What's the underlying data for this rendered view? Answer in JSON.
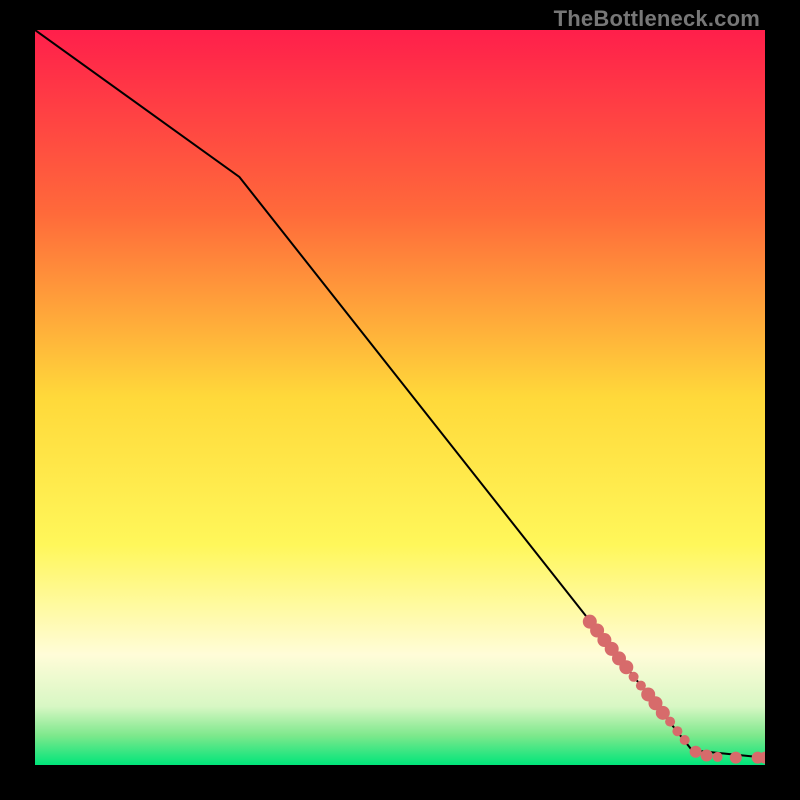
{
  "attribution": "TheBottleneck.com",
  "chart_data": {
    "type": "line",
    "title": "",
    "xlabel": "",
    "ylabel": "",
    "xlim": [
      0,
      100
    ],
    "ylim": [
      0,
      100
    ],
    "background_gradient": {
      "stops": [
        {
          "offset": 0.0,
          "color": "#ff1f4b"
        },
        {
          "offset": 0.25,
          "color": "#ff6a3a"
        },
        {
          "offset": 0.5,
          "color": "#ffd93a"
        },
        {
          "offset": 0.7,
          "color": "#fff75a"
        },
        {
          "offset": 0.85,
          "color": "#fffcd8"
        },
        {
          "offset": 0.92,
          "color": "#d8f7c4"
        },
        {
          "offset": 0.96,
          "color": "#7de88c"
        },
        {
          "offset": 1.0,
          "color": "#00e57a"
        }
      ]
    },
    "line": [
      {
        "x": 0,
        "y": 100
      },
      {
        "x": 28,
        "y": 80
      },
      {
        "x": 90,
        "y": 2
      },
      {
        "x": 100,
        "y": 1
      }
    ],
    "markers": {
      "color": "#d76b6b",
      "radius_small": 5,
      "radius_large": 7,
      "points": [
        {
          "x": 76.0,
          "y": 19.5,
          "r": 7
        },
        {
          "x": 77.0,
          "y": 18.3,
          "r": 7
        },
        {
          "x": 78.0,
          "y": 17.0,
          "r": 7
        },
        {
          "x": 79.0,
          "y": 15.8,
          "r": 7
        },
        {
          "x": 80.0,
          "y": 14.5,
          "r": 7
        },
        {
          "x": 81.0,
          "y": 13.3,
          "r": 7
        },
        {
          "x": 82.0,
          "y": 12.0,
          "r": 5
        },
        {
          "x": 83.0,
          "y": 10.8,
          "r": 5
        },
        {
          "x": 84.0,
          "y": 9.6,
          "r": 7
        },
        {
          "x": 85.0,
          "y": 8.4,
          "r": 7
        },
        {
          "x": 86.0,
          "y": 7.1,
          "r": 7
        },
        {
          "x": 87.0,
          "y": 5.9,
          "r": 5
        },
        {
          "x": 88.0,
          "y": 4.6,
          "r": 5
        },
        {
          "x": 89.0,
          "y": 3.4,
          "r": 5
        },
        {
          "x": 90.5,
          "y": 1.8,
          "r": 6
        },
        {
          "x": 92.0,
          "y": 1.3,
          "r": 6
        },
        {
          "x": 93.5,
          "y": 1.1,
          "r": 5
        },
        {
          "x": 96.0,
          "y": 1.0,
          "r": 6
        },
        {
          "x": 99.0,
          "y": 1.0,
          "r": 6
        },
        {
          "x": 100.0,
          "y": 1.0,
          "r": 6
        }
      ]
    }
  }
}
